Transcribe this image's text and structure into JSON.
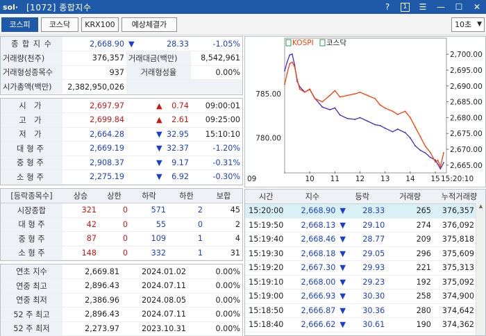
{
  "window": {
    "logo": "sol·",
    "title": "[1072] 종합지수",
    "help": "?",
    "num": "1",
    "menu": "☰",
    "minimize": "—",
    "maximize": "☐",
    "close": "✕"
  },
  "tabs": [
    "코스피",
    "코스닥",
    "KRX100",
    "예상체결가"
  ],
  "interval": "10초",
  "summary": [
    {
      "label": "종 합 지 수",
      "v1": "2,668.90",
      "arrow": "▼",
      "v2": "28.33",
      "v3": "-1.05%",
      "color": "blue"
    },
    {
      "label": "거래량(천주)",
      "v1": "376,357",
      "label2": "거래대금(백만)",
      "v3": "8,542,961"
    },
    {
      "label": "거래형성종목수",
      "v1": "937",
      "label2": "거래형성율",
      "v3": "0.00%"
    },
    {
      "label": "시가총액(백만)",
      "v1": "2,382,950,026"
    }
  ],
  "prices": [
    {
      "label": "시 가",
      "value": "2,697.97",
      "arrow": "▲",
      "change": "0.74",
      "extra": "09:00:01",
      "vc": "red",
      "ac": "red"
    },
    {
      "label": "고 가",
      "value": "2,699.84",
      "arrow": "▲",
      "change": "2.61",
      "extra": "09:25:00",
      "vc": "red",
      "ac": "red"
    },
    {
      "label": "저 가",
      "value": "2,664.28",
      "arrow": "▼",
      "change": "32.95",
      "extra": "15:10:10",
      "vc": "blue",
      "ac": "blue"
    },
    {
      "label": "대형주",
      "value": "2,669.19",
      "arrow": "▼",
      "change": "32.37",
      "extra": "-1.20%",
      "vc": "blue",
      "ac": "blue"
    },
    {
      "label": "중형주",
      "value": "2,908.37",
      "arrow": "▼",
      "change": "9.17",
      "extra": "-0.31%",
      "vc": "blue",
      "ac": "blue"
    },
    {
      "label": "소형주",
      "value": "2,275.19",
      "arrow": "▼",
      "change": "6.92",
      "extra": "-0.30%",
      "vc": "blue",
      "ac": "blue"
    }
  ],
  "breadth": {
    "headers": [
      "[등락종목수]",
      "상승",
      "상한",
      "하락",
      "하한",
      "보합"
    ],
    "rows": [
      {
        "label": "시장종합",
        "up": "321",
        "uplimit": "0",
        "down": "571",
        "downlimit": "2",
        "flat": "45"
      },
      {
        "label": "대 형 주",
        "up": "42",
        "uplimit": "0",
        "down": "55",
        "downlimit": "0",
        "flat": "2"
      },
      {
        "label": "중 형 주",
        "up": "87",
        "uplimit": "0",
        "down": "109",
        "downlimit": "1",
        "flat": "4"
      },
      {
        "label": "소 형 주",
        "up": "148",
        "uplimit": "0",
        "down": "332",
        "downlimit": "1",
        "flat": "31"
      }
    ]
  },
  "yearly": [
    {
      "label": "연초 지수",
      "value": "2,669.81",
      "date": "2024.01.02",
      "pct": "0.00%"
    },
    {
      "label": "연중 최고",
      "value": "2,896.43",
      "date": "2024.07.11",
      "pct": "0.00%"
    },
    {
      "label": "연중 최저",
      "value": "2,386.96",
      "date": "2024.08.05",
      "pct": "0.00%"
    },
    {
      "label": "52 주 최고",
      "value": "2,896.43",
      "date": "2024.07.11",
      "pct": "0.00%"
    },
    {
      "label": "52 주 최저",
      "value": "2,273.97",
      "date": "2023.10.31",
      "pct": "0.00%"
    }
  ],
  "ticks": {
    "headers": [
      "시간",
      "지수",
      "등락",
      "거래량",
      "누적거래량"
    ],
    "rows": [
      {
        "time": "15:20:00",
        "index": "2,668.90",
        "arrow": "▼",
        "change": "28.33",
        "vol": "265",
        "cum": "376,357"
      },
      {
        "time": "15:19:50",
        "index": "2,668.13",
        "arrow": "▼",
        "change": "29.10",
        "vol": "274",
        "cum": "376,092"
      },
      {
        "time": "15:19:40",
        "index": "2,668.46",
        "arrow": "▼",
        "change": "28.77",
        "vol": "209",
        "cum": "375,818"
      },
      {
        "time": "15:19:30",
        "index": "2,668.18",
        "arrow": "▼",
        "change": "29.05",
        "vol": "296",
        "cum": "375,609"
      },
      {
        "time": "15:19:20",
        "index": "2,667.30",
        "arrow": "▼",
        "change": "29.93",
        "vol": "221",
        "cum": "375,313"
      },
      {
        "time": "15:19:10",
        "index": "2,668.00",
        "arrow": "▼",
        "change": "29.23",
        "vol": "192",
        "cum": "375,092"
      },
      {
        "time": "15:19:00",
        "index": "2,666.93",
        "arrow": "▼",
        "change": "30.30",
        "vol": "258",
        "cum": "374,900"
      },
      {
        "time": "15:18:50",
        "index": "2,666.87",
        "arrow": "▼",
        "change": "30.36",
        "vol": "280",
        "cum": "374,642"
      },
      {
        "time": "15:18:40",
        "index": "2,666.62",
        "arrow": "▼",
        "change": "30.61",
        "vol": "190",
        "cum": "374,362"
      }
    ]
  },
  "chart_data": {
    "type": "line",
    "legend": [
      "KOSPI",
      "코스닥"
    ],
    "x_ticks": [
      "09",
      "10",
      "11",
      "12",
      "13",
      "14",
      "15",
      "15:20:10"
    ],
    "y_left_ticks": [
      "785.00",
      "780.00"
    ],
    "y_right_ticks": [
      "2,700.00",
      "2,695.00",
      "2,690.00",
      "2,685.00",
      "2,680.00",
      "2,675.00",
      "2,670.00",
      "2,665.00"
    ],
    "y_right_range": [
      2663,
      2702
    ],
    "y_left_range": [
      776.2,
      790.2
    ],
    "series": [
      {
        "name": "KOSPI",
        "color": "#ff3c00",
        "axis": "right",
        "points": [
          [
            9.0,
            2690.5
          ],
          [
            9.1,
            2694
          ],
          [
            9.2,
            2697
          ],
          [
            9.3,
            2697.5
          ],
          [
            9.4,
            2696
          ],
          [
            9.5,
            2692
          ],
          [
            9.6,
            2689
          ],
          [
            9.8,
            2688
          ],
          [
            10.0,
            2689
          ],
          [
            10.2,
            2686
          ],
          [
            10.5,
            2685
          ],
          [
            10.8,
            2687
          ],
          [
            11.0,
            2688.5
          ],
          [
            11.2,
            2686.5
          ],
          [
            11.5,
            2687
          ],
          [
            11.8,
            2687.5
          ],
          [
            12.0,
            2688
          ],
          [
            12.3,
            2687
          ],
          [
            12.6,
            2686
          ],
          [
            12.8,
            2684
          ],
          [
            13.0,
            2683
          ],
          [
            13.3,
            2682
          ],
          [
            13.5,
            2681
          ],
          [
            13.8,
            2682
          ],
          [
            14.0,
            2680
          ],
          [
            14.2,
            2677
          ],
          [
            14.4,
            2674
          ],
          [
            14.6,
            2671
          ],
          [
            14.8,
            2669
          ],
          [
            15.0,
            2666
          ],
          [
            15.1,
            2666.5
          ],
          [
            15.2,
            2664.5
          ],
          [
            15.33,
            2668.9
          ]
        ]
      },
      {
        "name": "코스닥",
        "color": "#3a2ad0",
        "axis": "left",
        "points": [
          [
            9.0,
            787.6
          ],
          [
            9.1,
            788.6
          ],
          [
            9.2,
            789.4
          ],
          [
            9.3,
            789.5
          ],
          [
            9.4,
            788.2
          ],
          [
            9.5,
            786.4
          ],
          [
            9.6,
            785.8
          ],
          [
            9.8,
            785.2
          ],
          [
            10.0,
            785.5
          ],
          [
            10.2,
            784.5
          ],
          [
            10.5,
            783.5
          ],
          [
            10.8,
            783.2
          ],
          [
            11.0,
            783.4
          ],
          [
            11.2,
            782.6
          ],
          [
            11.5,
            782.2
          ],
          [
            11.8,
            782.1
          ],
          [
            12.0,
            782.3
          ],
          [
            12.3,
            781.9
          ],
          [
            12.6,
            781.5
          ],
          [
            12.8,
            781.4
          ],
          [
            13.0,
            781.1
          ],
          [
            13.3,
            780.7
          ],
          [
            13.5,
            781.0
          ],
          [
            13.8,
            780.6
          ],
          [
            14.0,
            780.0
          ],
          [
            14.2,
            779.1
          ],
          [
            14.4,
            778.6
          ],
          [
            14.6,
            778.3
          ],
          [
            14.8,
            777.8
          ],
          [
            15.0,
            777.5
          ],
          [
            15.1,
            777.0
          ],
          [
            15.2,
            776.5
          ],
          [
            15.33,
            777.2
          ]
        ]
      }
    ]
  }
}
